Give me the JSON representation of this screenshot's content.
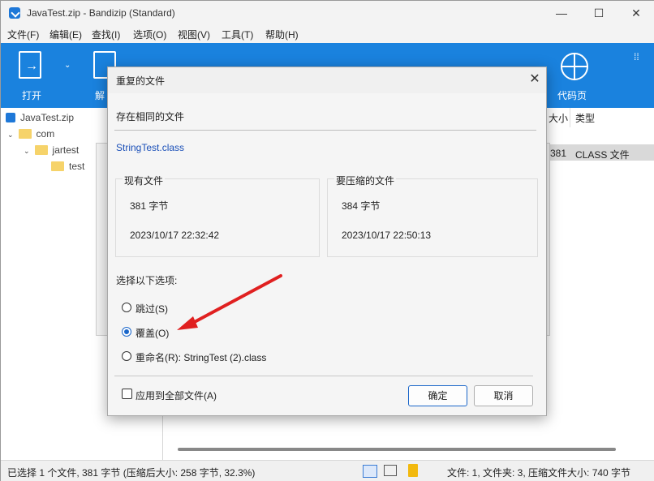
{
  "window": {
    "title": "JavaTest.zip - Bandizip (Standard)",
    "minimize": "—",
    "maximize": "☐",
    "close": "✕"
  },
  "menu": [
    "文件(F)",
    "编辑(E)",
    "查找(I)",
    "选项(O)",
    "视图(V)",
    "工具(T)",
    "帮助(H)"
  ],
  "toolbar": {
    "open_label": "打开",
    "extract_label": "解",
    "code_label": "代码页",
    "accent_color": "#1a82de"
  },
  "tree": {
    "root": "JavaTest.zip",
    "items": [
      "com",
      "jartest",
      "test"
    ]
  },
  "filelist": {
    "col_size_partial": "大小",
    "col_type": "类型",
    "row_size_partial": "381",
    "row_type": "CLASS 文件"
  },
  "statusbar": {
    "left": "已选择 1 个文件, 381 字节 (压缩后大小: 258 字节, 32.3%)",
    "right": "文件: 1, 文件夹: 3, 压缩文件大小: 740 字节"
  },
  "dialog": {
    "title": "重复的文件",
    "close": "✕",
    "header": "存在相同的文件",
    "filename": "StringTest.class",
    "existing": {
      "legend": "现有文件",
      "size": "381 字节",
      "date": "2023/10/17 22:32:42"
    },
    "incoming": {
      "legend": "要压缩的文件",
      "size": "384 字节",
      "date": "2023/10/17 22:50:13"
    },
    "options_label": "选择以下选项:",
    "options": [
      "跳过(S)",
      "覆盖(O)",
      "重命名(R): StringTest (2).class"
    ],
    "selected_option": 1,
    "apply_all": "应用到全部文件(A)",
    "ok": "确定",
    "cancel": "取消",
    "arrow_color": "#e02020"
  }
}
